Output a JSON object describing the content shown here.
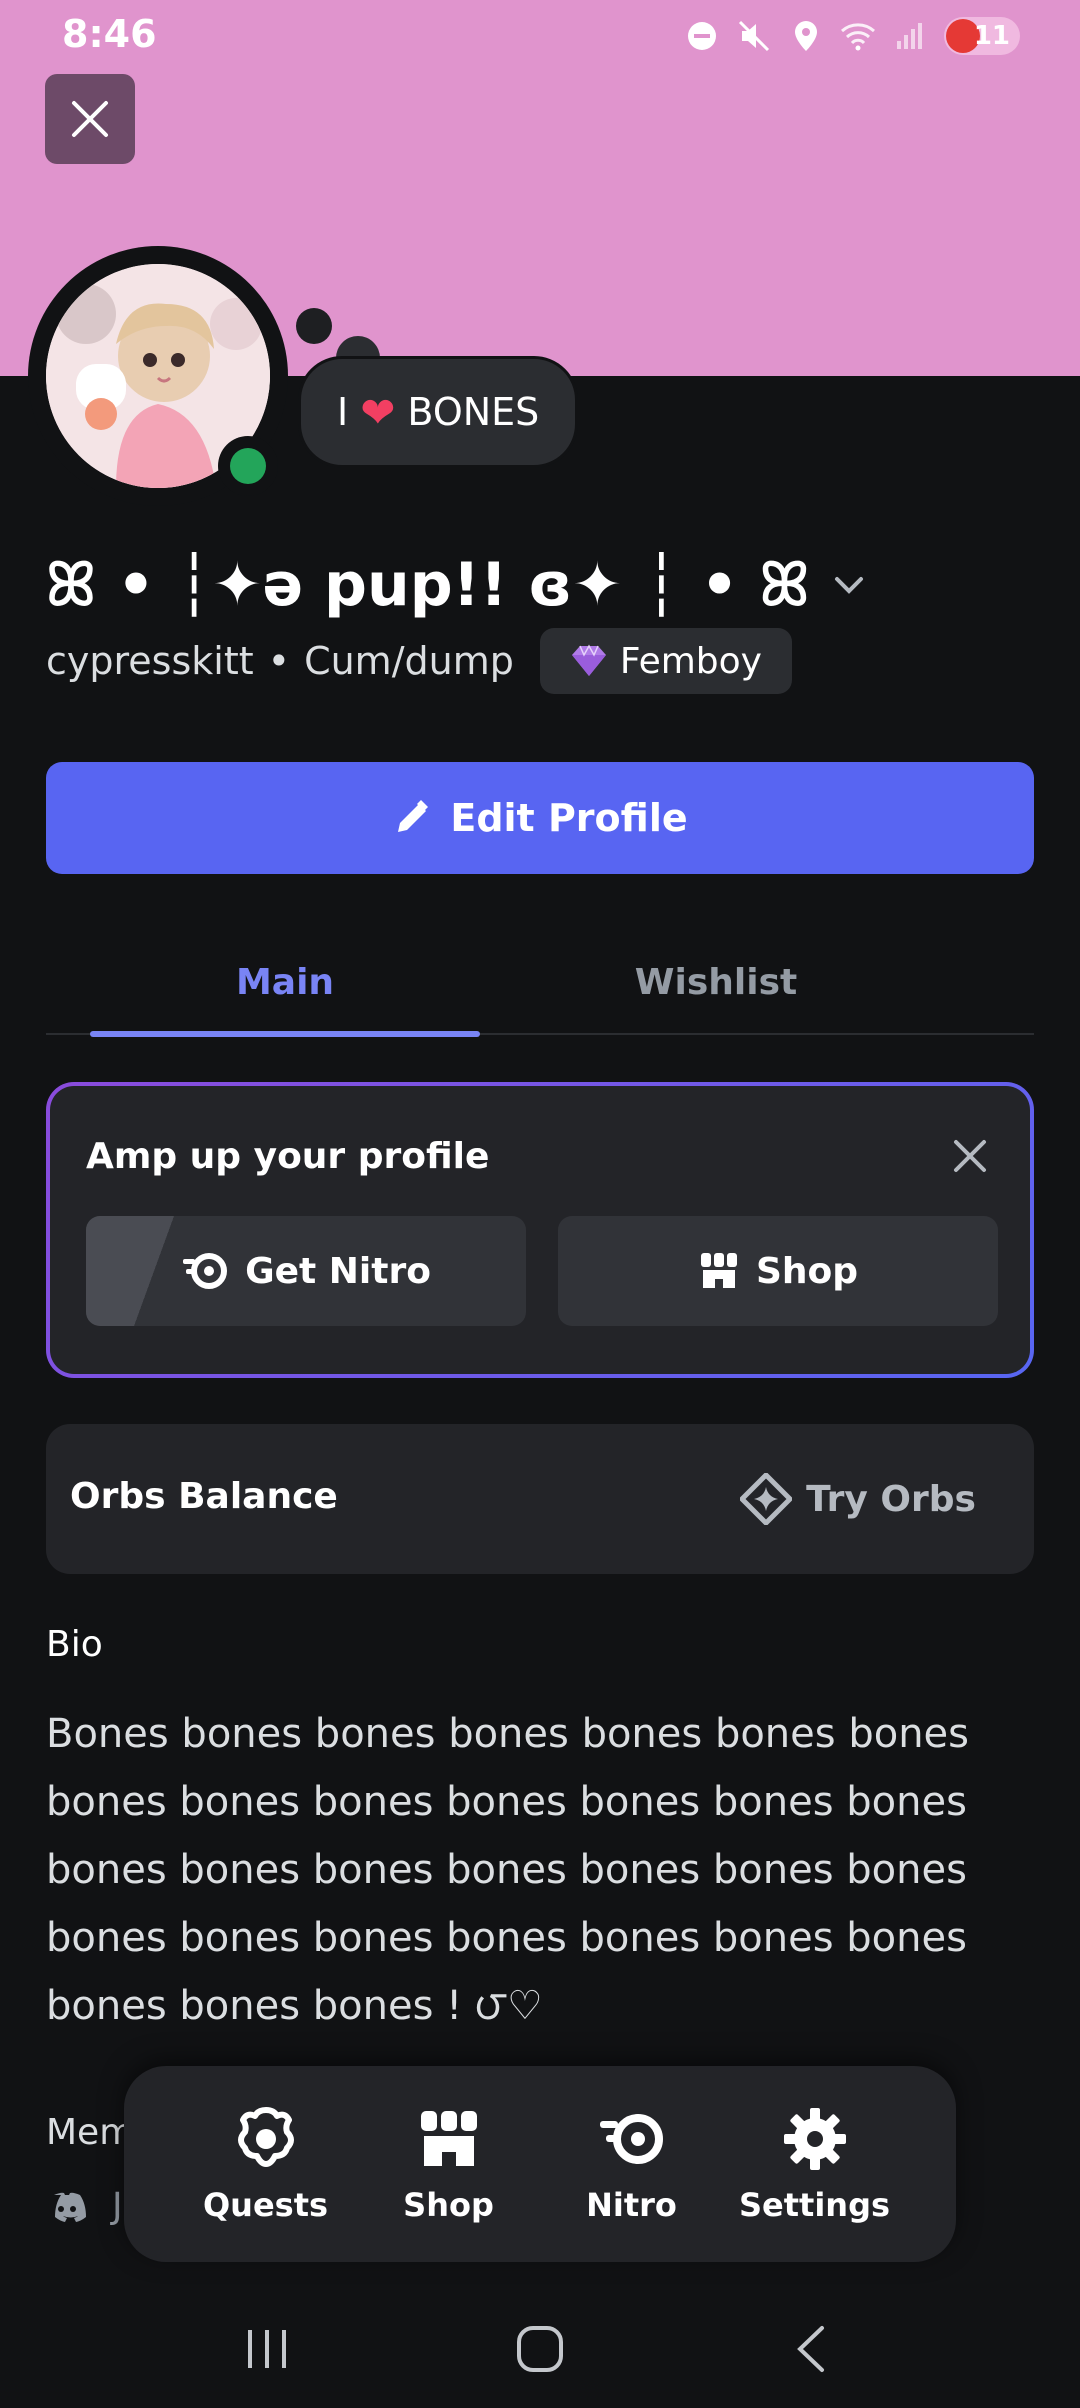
{
  "status_bar": {
    "time": "8:46",
    "battery": "11",
    "icons": [
      "do-not-disturb-icon",
      "mute-icon",
      "location-icon",
      "wifi-icon",
      "signal-icon"
    ]
  },
  "profile": {
    "banner_color": "#e094cd",
    "status_bubble": {
      "prefix": "I",
      "emoji": "❤",
      "text": "BONES"
    },
    "display_name": "ꕤ • ┆✦ə pup!! ɞ✦ ┆ • ꕤ",
    "username": "cypresskitt",
    "pronouns": "Cum/dump",
    "separator": "•",
    "tag": "Femboy",
    "online": true
  },
  "actions": {
    "edit_profile": "Edit Profile"
  },
  "tabs": [
    {
      "label": "Main",
      "active": true
    },
    {
      "label": "Wishlist",
      "active": false
    }
  ],
  "amp_card": {
    "title": "Amp up your profile",
    "get_nitro": "Get Nitro",
    "shop": "Shop"
  },
  "orbs": {
    "title": "Orbs Balance",
    "try": "Try Orbs"
  },
  "bio": {
    "label": "Bio",
    "text": "Bones bones bones bones bones bones bones bones bones bones bones bones bones bones bones bones bones bones bones bones bones bones bones bones bones bones bones bones bones bones bones ! ౮♡"
  },
  "member": {
    "label": "Mem",
    "value": "J"
  },
  "bottom_nav": [
    {
      "label": "Quests",
      "icon": "quests-icon"
    },
    {
      "label": "Shop",
      "icon": "shop-icon"
    },
    {
      "label": "Nitro",
      "icon": "nitro-icon"
    },
    {
      "label": "Settings",
      "icon": "settings-icon"
    }
  ],
  "system_nav": [
    "recents-icon",
    "home-icon",
    "back-icon"
  ],
  "colors": {
    "background": "#111214",
    "accent": "#5865f2",
    "tab_active": "#7984f5",
    "online": "#23a55a"
  }
}
